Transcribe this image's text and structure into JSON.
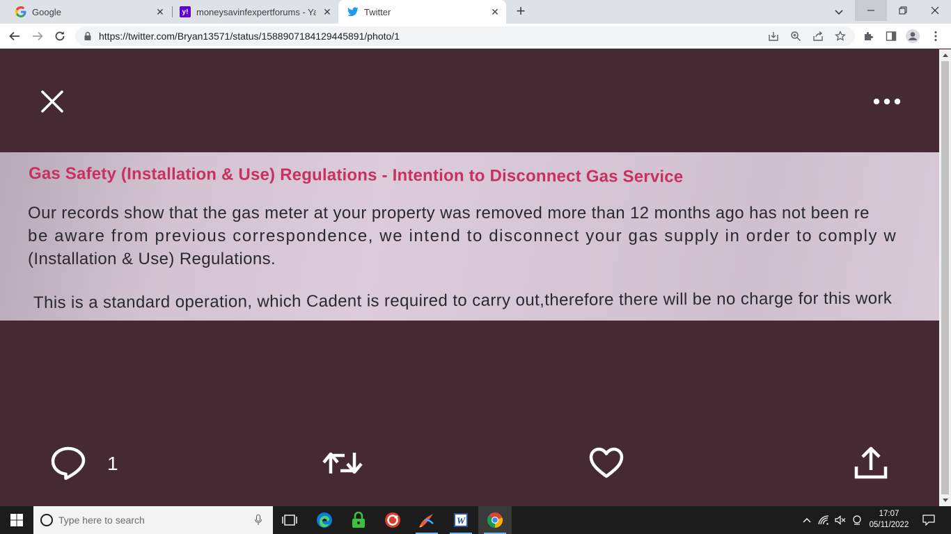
{
  "browser": {
    "tabs": [
      {
        "title": "Google",
        "favicon": "google-icon",
        "active": false
      },
      {
        "title": "moneysavinfexpertforums - Yahoo",
        "favicon": "yahoo-icon",
        "active": false
      },
      {
        "title": "Twitter",
        "favicon": "twitter-icon",
        "active": true
      }
    ],
    "url": "https://twitter.com/Bryan13571/status/1588907184129445891/photo/1"
  },
  "viewer": {
    "photo": {
      "heading": "Gas Safety (Installation & Use) Regulations - Intention to Disconnect Gas Service",
      "lines": [
        "Our records show that the gas meter at your property was removed more than 12 months ago has not been re",
        "be aware from previous correspondence, we intend to disconnect your gas supply in order to comply w",
        "(Installation & Use) Regulations.",
        "This is a standard operation, which Cadent is required to carry out,therefore there will be no charge for this work"
      ]
    },
    "actions": {
      "reply_count": "1"
    }
  },
  "taskbar": {
    "search_placeholder": "Type here to search",
    "time": "17:07",
    "date": "05/11/2022"
  },
  "colors": {
    "viewer_bg": "#452a34",
    "heading_red": "#c8315f",
    "twitter_blue": "#1d9bf0",
    "yahoo_purple": "#6001d2"
  }
}
